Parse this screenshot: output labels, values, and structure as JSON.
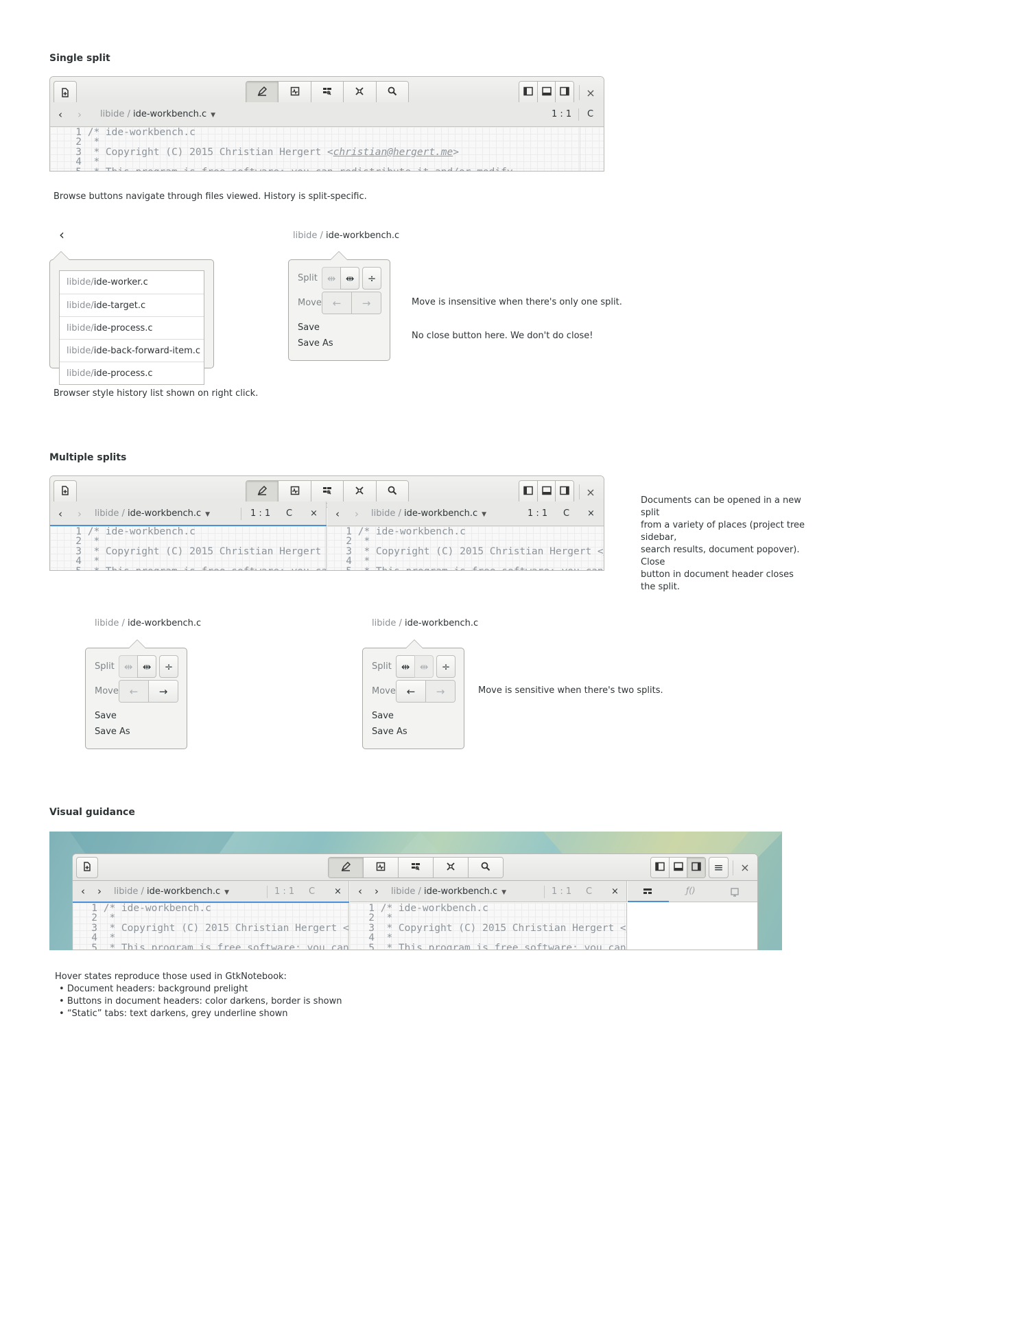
{
  "sections": {
    "single": "Single split",
    "multiple": "Multiple splits",
    "visual": "Visual guidance"
  },
  "document": {
    "dir": "libide",
    "sep": " / ",
    "file": "ide-workbench.c",
    "position": "1 : 1",
    "lang": "C",
    "close_glyph": "×"
  },
  "code_lines": [
    {
      "num": "1",
      "text": "/* ide-workbench.c"
    },
    {
      "num": "2",
      "text": " *"
    },
    {
      "num": "3",
      "text": " * Copyright (C) 2015 Christian Hergert <",
      "email": "christian@hergert.me",
      "after": ">"
    },
    {
      "num": "4",
      "text": " *"
    },
    {
      "num": "5",
      "text": " * This program is free software: you can redistribute it and/or modify"
    }
  ],
  "notes": {
    "browse": "Browse buttons navigate through files viewed. History is split-specific.",
    "history": "Browser style history list shown on right click.",
    "move_insensitive": "Move is insensitive when there's only one split.",
    "no_close": "No close button here. We don't do close!",
    "open_split": [
      "Documents can be opened in a new split",
      "from a variety of places (project tree sidebar,",
      "search results, document popover). Close",
      "button in document header closes the split."
    ],
    "move_sensitive": "Move is sensitive when there's two splits.",
    "hover_title": "Hover states reproduce those used in GtkNotebook:",
    "hover_items": [
      "Document headers: background prelight",
      "Buttons in document headers: color darkens, border is shown",
      "“Static” tabs: text darkens, grey underline shown"
    ]
  },
  "history_list": [
    {
      "dir": "libide",
      "file": "ide-worker.c"
    },
    {
      "dir": "libide",
      "file": "ide-target.c"
    },
    {
      "dir": "libide",
      "file": "ide-process.c"
    },
    {
      "dir": "libide",
      "file": "ide-back-forward-item.c"
    },
    {
      "dir": "libide",
      "file": "ide-process.c"
    }
  ],
  "popover": {
    "split_label": "Split",
    "move_label": "Move",
    "save": "Save",
    "save_as": "Save As",
    "arrow_left": "←",
    "arrow_right": "→"
  },
  "glyphs": {
    "back": "‹",
    "forward": "›",
    "caret": "▼",
    "menu": "≡"
  },
  "icons": [
    "new-document-icon",
    "editor-perspective-icon",
    "build-perspective-icon",
    "profiler-perspective-icon",
    "preferences-perspective-icon",
    "search-icon",
    "left-panel-icon",
    "bottom-panel-icon",
    "right-panel-icon"
  ],
  "colors": {
    "accent": "#4a90d9",
    "header": "#e8e8e7",
    "editor_bg": "#f8f8f8"
  }
}
